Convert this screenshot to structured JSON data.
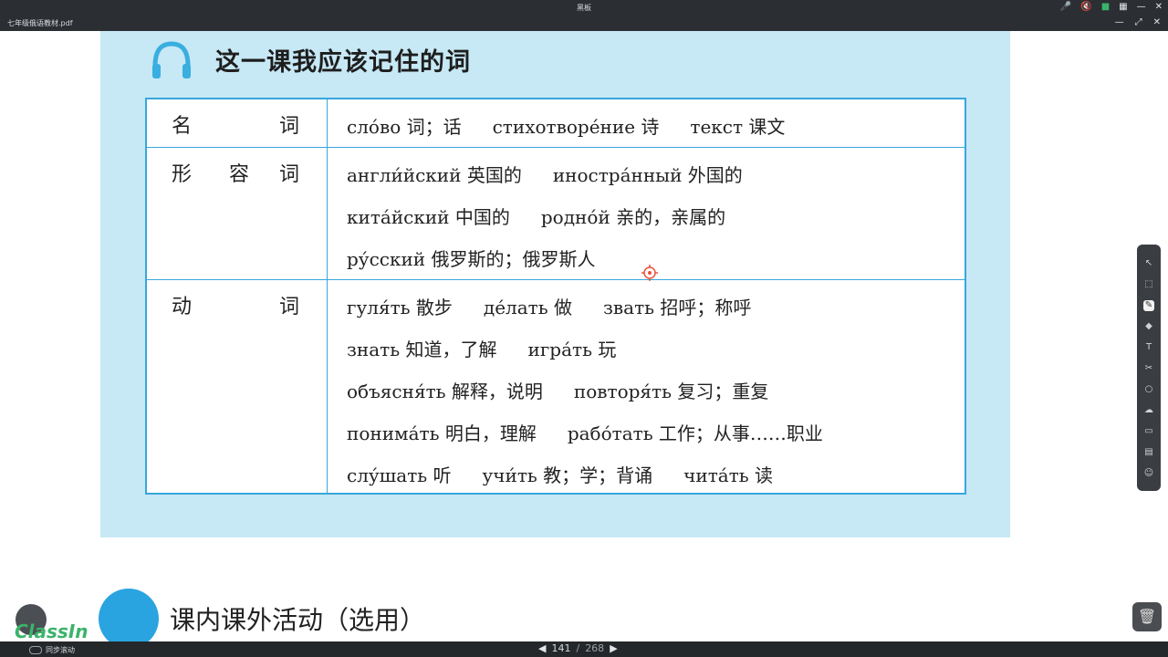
{
  "window": {
    "title": "黑板"
  },
  "tab": {
    "filename": "七年级俄语教材.pdf"
  },
  "section": {
    "title": "这一课我应该记住的词"
  },
  "table": {
    "rows": [
      {
        "category": [
          "名",
          "",
          "词"
        ],
        "lines": [
          [
            "сло́во 词；话",
            "стихотворе́ние 诗",
            "текст 课文"
          ]
        ]
      },
      {
        "category": [
          "形",
          "容",
          "词"
        ],
        "lines": [
          [
            "англи́йский 英国的",
            "иностра́нный 外国的"
          ],
          [
            "кита́йский 中国的",
            "родно́й 亲的，亲属的"
          ],
          [
            "ру́сский 俄罗斯的；俄罗斯人"
          ]
        ]
      },
      {
        "category": [
          "动",
          "",
          "词"
        ],
        "lines": [
          [
            "гуля́ть 散步",
            "де́лать 做",
            "звать 招呼；称呼"
          ],
          [
            "знать 知道，了解",
            "игра́ть 玩"
          ],
          [
            "объясня́ть 解释，说明",
            "повторя́ть 复习；重复"
          ],
          [
            "понима́ть 明白，理解",
            "рабо́тать 工作；从事……职业"
          ],
          [
            "слу́шать 听",
            "учи́ть 教；学；背诵",
            "чита́ть 读"
          ]
        ]
      }
    ]
  },
  "activities": {
    "title": "课内课外活动（选用）"
  },
  "branding": {
    "logo": "ClassIn"
  },
  "bottom": {
    "sync_label": "同步滚动",
    "page_current": "141",
    "page_separator": " / ",
    "page_total": "268"
  },
  "colors": {
    "table_border": "#37a7dc",
    "panel_bg": "#c7e8f5",
    "accent": "#2aa4e0"
  }
}
